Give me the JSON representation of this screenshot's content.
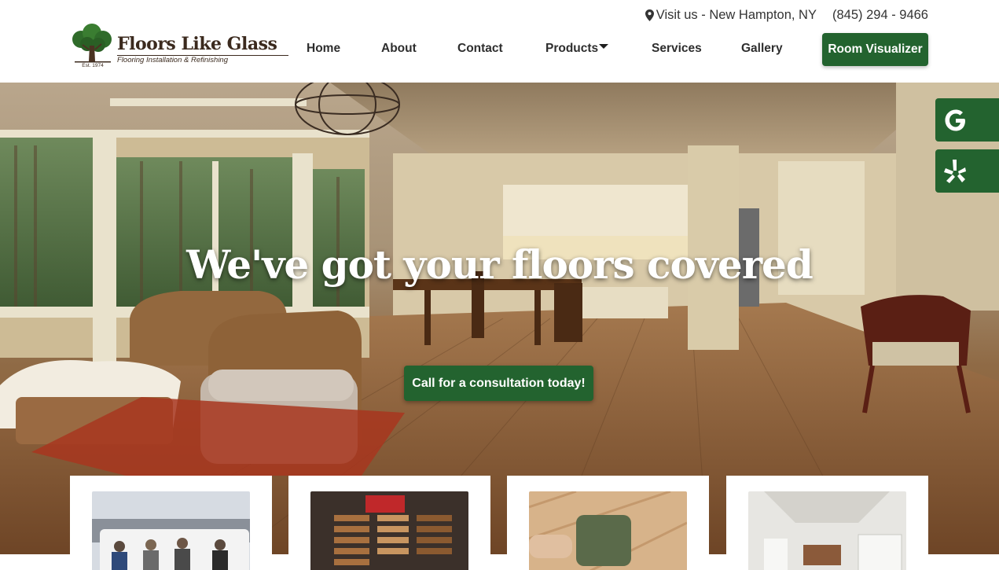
{
  "header": {
    "logo": {
      "name": "Floors Like Glass",
      "tagline": "Flooring Installation & Refinishing",
      "est": "Est. 1974"
    },
    "location_text": "Visit us - New Hampton, NY",
    "phone": "(845) 294 - 9466",
    "nav": [
      {
        "label": "Home"
      },
      {
        "label": "About"
      },
      {
        "label": "Contact"
      },
      {
        "label": "Products"
      },
      {
        "label": "Services"
      },
      {
        "label": "Gallery"
      }
    ],
    "cta_label": "Room Visualizer"
  },
  "hero": {
    "title": "We've got your floors covered",
    "cta_label": "Call for a consultation today!"
  },
  "social": [
    {
      "icon": "google-icon"
    },
    {
      "icon": "yelp-icon"
    }
  ],
  "colors": {
    "brand_green": "#23632f",
    "logo_brown": "#3b2a1e"
  }
}
